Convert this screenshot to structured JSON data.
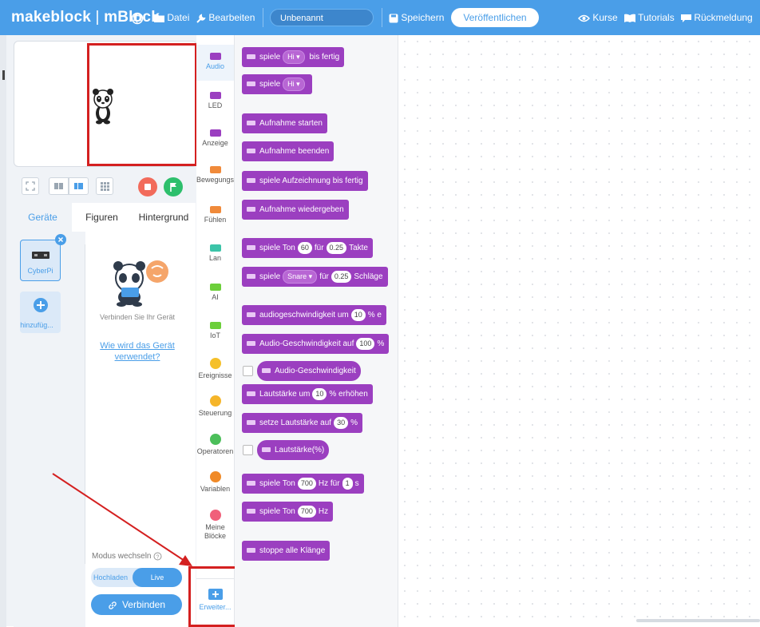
{
  "topbar": {
    "logo_main": "makeblock",
    "logo_sep": " | ",
    "logo_product": "mBlock",
    "menu_file": "Datei",
    "menu_edit": "Bearbeiten",
    "project_title": "Unbenannt",
    "save": "Speichern",
    "publish": "Veröffentlichen",
    "courses": "Kurse",
    "tutorials": "Tutorials",
    "feedback": "Rückmeldung"
  },
  "left": {
    "tabs": [
      "Geräte",
      "Figuren",
      "Hintergrund"
    ],
    "device_name": "CyberPi",
    "add_device": "hinzufüg...",
    "connect_hint": "Verbinden Sie Ihr Gerät",
    "how_to_link": "Wie wird das Gerät verwendet?",
    "mode_label": "Modus wechseln",
    "mode_upload": "Hochladen",
    "mode_live": "Live",
    "connect_button": "Verbinden"
  },
  "categories": [
    {
      "label": "Audio",
      "color": "#9b3fc0",
      "shape": "square"
    },
    {
      "label": "LED",
      "color": "#9b3fc0",
      "shape": "square"
    },
    {
      "label": "Anzeige",
      "color": "#9b3fc0",
      "shape": "square"
    },
    {
      "label": "Bewegungs",
      "color": "#f08a3a",
      "shape": "square"
    },
    {
      "label": "Fühlen",
      "color": "#f08a3a",
      "shape": "square"
    },
    {
      "label": "Lan",
      "color": "#3cc4a8",
      "shape": "square"
    },
    {
      "label": "AI",
      "color": "#6ccf3a",
      "shape": "square"
    },
    {
      "label": "IoT",
      "color": "#6ccf3a",
      "shape": "square"
    },
    {
      "label": "Ereignisse",
      "color": "#f5c02a",
      "shape": "circle"
    },
    {
      "label": "Steuerung",
      "color": "#f5b52a",
      "shape": "circle"
    },
    {
      "label": "Operatoren",
      "color": "#4cbf5a",
      "shape": "circle"
    },
    {
      "label": "Variablen",
      "color": "#f08a28",
      "shape": "circle"
    },
    {
      "label": "Meine Blöcke",
      "color": "#f0607a",
      "shape": "circle"
    }
  ],
  "extension_label": "Erweiter...",
  "blocks": {
    "b1": {
      "a": "spiele",
      "d": "Hi ▾",
      "b": "bis fertig"
    },
    "b2": {
      "a": "spiele",
      "d": "Hi ▾"
    },
    "b3": "Aufnahme starten",
    "b4": "Aufnahme beenden",
    "b5": "spiele Aufzeichnung bis fertig",
    "b6": "Aufnahme wiedergeben",
    "b7": {
      "a": "spiele Ton",
      "v1": "60",
      "m": "für",
      "v2": "0.25",
      "b": "Takte"
    },
    "b8": {
      "a": "spiele",
      "d": "Snare ▾",
      "m": "für",
      "v": "0.25",
      "b": "Schläge"
    },
    "b9": {
      "a": "audiogeschwindigkeit um",
      "v": "10",
      "b": "% e"
    },
    "b10": {
      "a": "Audio-Geschwindigkeit auf",
      "v": "100",
      "b": "%"
    },
    "b11": "Audio-Geschwindigkeit",
    "b12": {
      "a": "Lautstärke um",
      "v": "10",
      "b": "% erhöhen"
    },
    "b13": {
      "a": "setze Lautstärke auf",
      "v": "30",
      "b": "%"
    },
    "b14": "Lautstärke(%)",
    "b15": {
      "a": "spiele Ton",
      "v1": "700",
      "m": "Hz für",
      "v2": "1",
      "b": "s"
    },
    "b16": {
      "a": "spiele Ton",
      "v": "700",
      "b": "Hz"
    },
    "b17": "stoppe alle Klänge"
  },
  "colors": {
    "topbar": "#4a9ee8",
    "audio_block": "#9b3fc0",
    "annotation": "#d42020",
    "stop": "#f26b5b",
    "go": "#2dbf6c"
  }
}
